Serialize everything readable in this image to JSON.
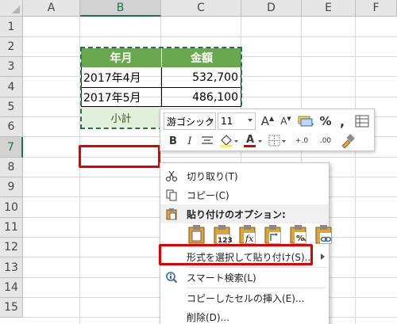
{
  "columns": [
    "A",
    "B",
    "C",
    "D",
    "E",
    "F"
  ],
  "rows": [
    "1",
    "2",
    "3",
    "4",
    "5",
    "6",
    "7",
    "8",
    "9",
    "10",
    "11",
    "12",
    "13",
    "14",
    "15"
  ],
  "selected_col": "B",
  "selected_row": "7",
  "table": {
    "header": [
      "年月",
      "金額"
    ],
    "data": [
      {
        "month": "2017年4月",
        "amount": "532,700"
      },
      {
        "month": "2017年5月",
        "amount": "486,100"
      }
    ],
    "subtotal_label": "小計"
  },
  "mini_toolbar": {
    "font_name": "游ゴシック",
    "font_size": "11",
    "bold": "B",
    "italic": "I",
    "font_color_glyph": "A",
    "percent": "%",
    "comma": ",",
    "increase_decimal": "+.0",
    "decrease_decimal": ".00"
  },
  "context_menu": {
    "cut": "切り取り(T)",
    "copy": "コピー(C)",
    "paste_options": "貼り付けのオプション:",
    "paste_special": "形式を選択して貼り付け(S)...",
    "smart_lookup": "スマート検索(L)",
    "insert_copied": "コピーしたセルの挿入(E)...",
    "delete": "削除(D)..."
  },
  "colors": {
    "header_bg": "#6aa84f",
    "subtotal_bg": "#e2efda",
    "excel_green": "#217346",
    "highlight_red": "#e00000"
  }
}
